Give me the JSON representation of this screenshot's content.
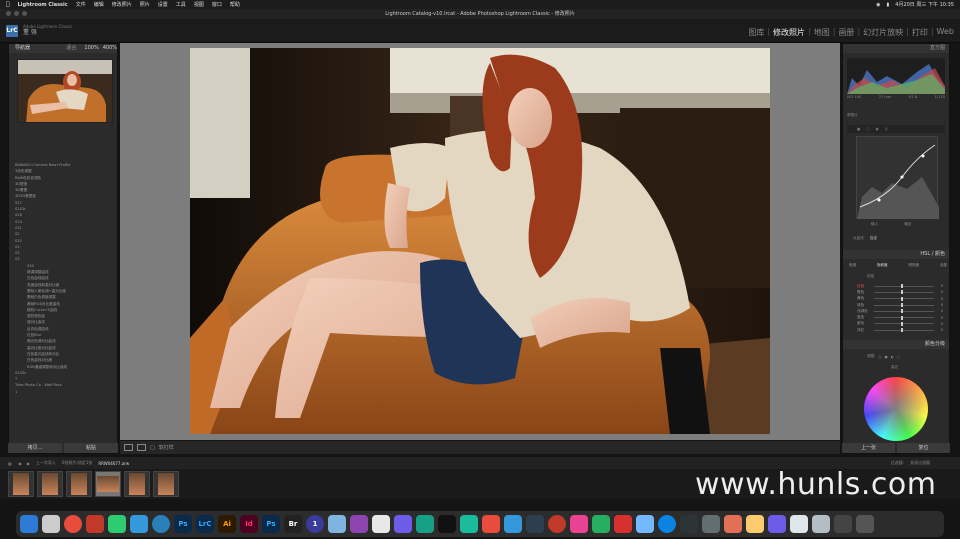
{
  "menubar": {
    "app": "Lightroom Classic",
    "items": [
      "文件",
      "编辑",
      "修改照片",
      "照片",
      "设置",
      "工具",
      "视图",
      "窗口",
      "帮助"
    ],
    "clock": "4月20日 周三 下午 10:35"
  },
  "window": {
    "title": "Lightroom Catalog-v10.lrcat - Adobe Photoshop Lightroom Classic - 修改照片"
  },
  "identity": {
    "logo": "LrC",
    "subtitle": "Adobe Lightroom Classic",
    "name": "董 强"
  },
  "modules": {
    "items": [
      "图库",
      "修改照片",
      "地图",
      "画册",
      "幻灯片放映",
      "打印",
      "Web"
    ],
    "separator": "|",
    "active": "修改照片"
  },
  "left": {
    "navigator": "导航器",
    "nav_options": [
      "适合",
      "100%",
      "400%"
    ],
    "folders": [
      "RAWADS+Camera Raw+Profile",
      "3色彩调整",
      "RAW色彩依调色",
      "3D塑造",
      "3D看图",
      "3D3D看塑造",
      "S27",
      "S2S3t",
      "S28",
      "S24",
      "S31",
      "S2",
      "S32",
      "S3",
      "S3",
      "S3"
    ],
    "presets": [
      "S30",
      "精调调整曲线",
      "白色曲线曲线",
      "亮度曲线和高对比度",
      "基础人像色调+高对比度",
      "基础白色调度调整",
      "基础RGB对比度曲线",
      "随机Curve+S曲线",
      "强烈调色曲",
      "强对比曲线",
      "反向色调曲线",
      "红色Blur",
      "暗光色调对比曲线",
      "高对比度对比曲线",
      "白色高光曲线和对比",
      "白色曲线对比度",
      "RGB通道调整和对比曲线"
    ],
    "tail": [
      "S2S3s",
      "T",
      "Tribe Photo Co - Wolf Pack",
      "1",
      "..."
    ],
    "copy": "拷贝...",
    "paste": "粘贴"
  },
  "right": {
    "histogram": "直方图",
    "info": [
      "ISO 100",
      "27 mm",
      "f/1.8",
      "1/125"
    ],
    "original": "原照片",
    "curve_channel": "点曲线",
    "curve_value": "自定",
    "input": "输入",
    "output": "输出",
    "hsl": "HSL / 颜色",
    "hsl_tabs": [
      "色相",
      "饱和度",
      "明亮度",
      "全部"
    ],
    "hsl_sub": "色相",
    "hsl_rows": [
      "红色",
      "橙色",
      "黄色",
      "绿色",
      "浅绿色",
      "蓝色",
      "紫色",
      "洋红"
    ],
    "hsl_values": [
      "0",
      "0",
      "0",
      "0",
      "0",
      "0",
      "0",
      "0"
    ],
    "color_grading": "颜色分级",
    "cg_mode": "调整:",
    "highlights": "高光",
    "prev": "上一张",
    "reset": "复位"
  },
  "toolstrip": {
    "soft_proof": "软打样"
  },
  "filmstrip": {
    "label": "上一次导入",
    "count": "6张照片/选定1张",
    "file": "RRW04677.arw",
    "filter": "过滤器:",
    "filter_value": "关闭过滤器"
  },
  "watermark": "www.hunls.com",
  "dock": [
    "Finder",
    "Launchpad",
    "Chrome",
    "WPS",
    "WeChat",
    "QQ",
    "Safari",
    "Ps",
    "LrC",
    "Ai",
    "Id",
    "Ps",
    "Br",
    "1",
    "...",
    "Music",
    "Mail",
    "Store"
  ]
}
